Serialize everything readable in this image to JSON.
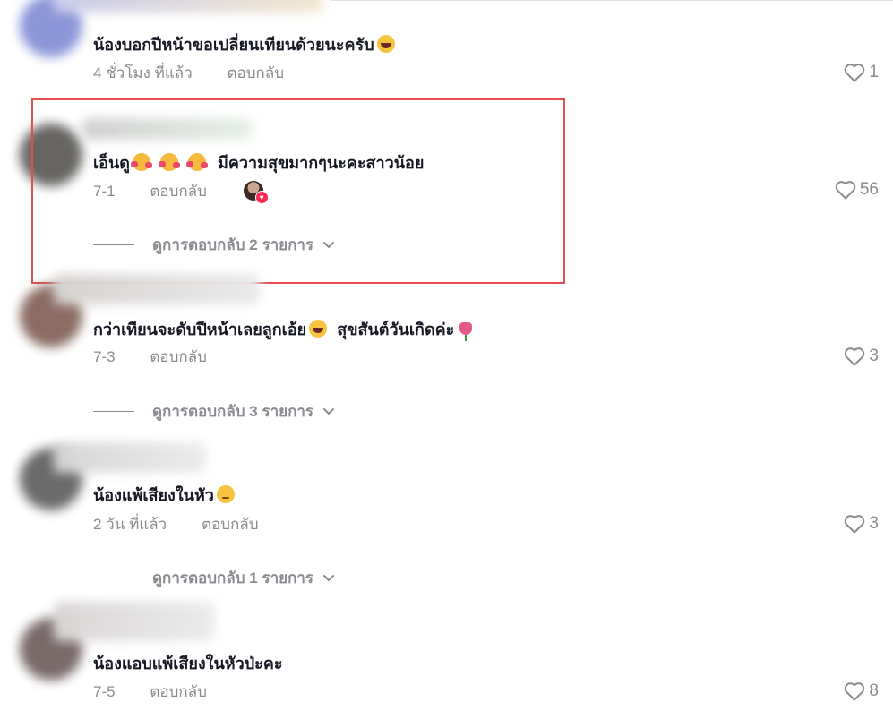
{
  "comments": [
    {
      "text": "น้องบอกปีหน้าขอเปลี่ยนเทียนด้วยนะครับ",
      "emoji": [
        "laughing-with-tears-emoji"
      ],
      "time": "4 ชั่วโมง ที่แล้ว",
      "reply_label": "ตอบกลับ",
      "likes": "1",
      "view_replies": ""
    },
    {
      "text_before": "เอ็นดู",
      "text": "มีความสุขมากๆนะคะสาวน้อย",
      "emoji": [
        "smiling-face-with-hearts-emoji",
        "smiling-face-with-hearts-emoji",
        "smiling-face-with-hearts-emoji"
      ],
      "time": "7-1",
      "reply_label": "ตอบกลับ",
      "creator_liked": true,
      "likes": "56",
      "view_replies": "ดูการตอบกลับ 2 รายการ"
    },
    {
      "text": "กว่าเทียนจะดับปีหน้าเลยลูกเอ้ย",
      "text_after": "สุขสันต์วันเกิดค่ะ",
      "emoji": [
        "laughing-with-tears-emoji",
        "tulip-emoji"
      ],
      "time": "7-3",
      "reply_label": "ตอบกลับ",
      "likes": "3",
      "view_replies": "ดูการตอบกลับ 3 รายการ"
    },
    {
      "text": "น้องแพ้เสียงในหัว",
      "emoji": [
        "pensive-face-emoji"
      ],
      "time": "2 วัน ที่แล้ว",
      "reply_label": "ตอบกลับ",
      "likes": "3",
      "view_replies": "ดูการตอบกลับ 1 รายการ"
    },
    {
      "text": "น้องแอบแพ้เสียงในหัวป่ะคะ",
      "emoji": [],
      "time": "7-5",
      "reply_label": "ตอบกลับ",
      "likes": "8",
      "view_replies": ""
    }
  ],
  "colors": {
    "text_primary": "#161823",
    "text_secondary": "#8a8b91",
    "highlight_border": "#e0504f",
    "creator_heart": "#fe2c55"
  }
}
